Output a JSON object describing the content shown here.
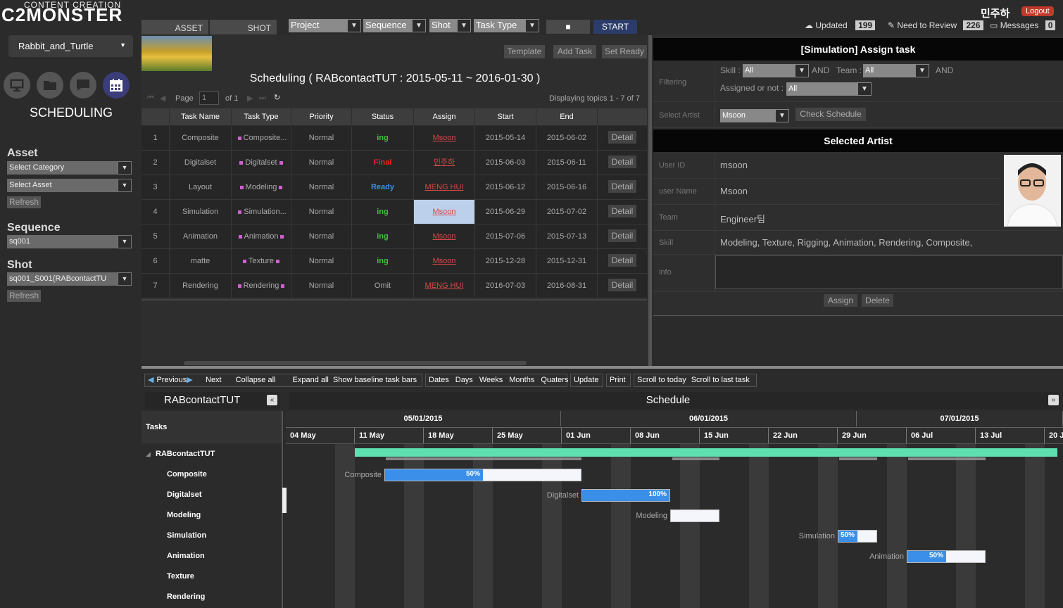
{
  "brand": {
    "line1": "CONTENT CREATION",
    "line2": "C2MONSTER"
  },
  "project": "Rabbit_and_Turtle",
  "nav": {
    "active": "SCHEDULING",
    "icons": [
      "monitor-icon",
      "folder-icon",
      "chat-icon",
      "calendar-icon"
    ]
  },
  "sidebar": {
    "asset_label": "Asset",
    "asset_category": "Select Category",
    "asset_asset": "Select Asset",
    "refresh1": "Refresh",
    "sequence_label": "Sequence",
    "sequence_value": "sq001",
    "shot_label": "Shot",
    "shot_value": "sq001_S001(RABcontactTU",
    "refresh2": "Refresh"
  },
  "tabs": {
    "asset": "ASSET",
    "shot": "SHOT"
  },
  "filters": {
    "project": "Project",
    "sequence": "Sequence",
    "shot": "Shot",
    "task_type": "Task Type",
    "start": "START"
  },
  "user": {
    "name": "민주하",
    "logout": "Logout",
    "updated_label": "Updated",
    "updated_count": "199",
    "review_label": "Need to Review",
    "review_count": "226",
    "messages_label": "Messages",
    "messages_count": "0"
  },
  "panel": {
    "template": "Template",
    "add_task": "Add Task",
    "set_ready": "Set Ready",
    "title": "Scheduling ( RABcontactTUT : 2015-05-11 ~ 2016-01-30 )",
    "page_label": "Page",
    "page_value": "1",
    "page_of": "of 1",
    "displaying": "Displaying topics 1 - 7 of 7"
  },
  "table": {
    "headers": [
      "Task Name",
      "Task Type",
      "Priority",
      "Status",
      "Assign",
      "Start",
      "End"
    ],
    "rows": [
      {
        "no": "1",
        "name": "Composite",
        "type": "Composite...",
        "priority": "Normal",
        "status": "ing",
        "status_class": "ing",
        "assign": "Msoon",
        "start": "2015-05-14",
        "end": "2015-06-02",
        "detail": "Detail"
      },
      {
        "no": "2",
        "name": "Digitalset",
        "type": "Digitalset",
        "priority": "Normal",
        "status": "Final",
        "status_class": "final",
        "assign": "민주하",
        "start": "2015-06-03",
        "end": "2015-06-11",
        "detail": "Detail"
      },
      {
        "no": "3",
        "name": "Layout",
        "type": "Modeling",
        "priority": "Normal",
        "status": "Ready",
        "status_class": "ready",
        "assign": "MENG HUI",
        "start": "2015-06-12",
        "end": "2015-06-16",
        "detail": "Detail"
      },
      {
        "no": "4",
        "name": "Simulation",
        "type": "Simulation...",
        "priority": "Normal",
        "status": "ing",
        "status_class": "ing",
        "assign": "Msoon",
        "start": "2015-06-29",
        "end": "2015-07-02",
        "detail": "Detail"
      },
      {
        "no": "5",
        "name": "Animation",
        "type": "Animation",
        "priority": "Normal",
        "status": "ing",
        "status_class": "ing",
        "assign": "Msoon",
        "start": "2015-07-06",
        "end": "2015-07-13",
        "detail": "Detail"
      },
      {
        "no": "6",
        "name": "matte",
        "type": "Texture",
        "priority": "Normal",
        "status": "ing",
        "status_class": "ing",
        "assign": "Msoon",
        "start": "2015-12-28",
        "end": "2015-12-31",
        "detail": "Detail"
      },
      {
        "no": "7",
        "name": "Rendering",
        "type": "Rendering",
        "priority": "Normal",
        "status": "Omit",
        "status_class": "omit",
        "assign": "MENG HUI",
        "start": "2016-07-03",
        "end": "2016-08-31",
        "detail": "Detail"
      }
    ]
  },
  "assign_panel": {
    "title": "[Simulation] Assign task",
    "filtering": "Filtering",
    "skill_label": "Skill :",
    "skill_value": "All",
    "and1": "AND",
    "team_label": "Team :",
    "team_value": "All",
    "and2": "AND",
    "assigned_label": "Assigned or not :",
    "assigned_value": "All",
    "select_artist": "Select Artist",
    "artist_value": "Msoon",
    "check_schedule": "Check Schedule",
    "selected_title": "Selected Artist",
    "user_id_label": "User ID",
    "user_id": "msoon",
    "user_name_label": "user Name",
    "user_name": "Msoon",
    "team_l": "Team",
    "team_v": "Engineer팀",
    "skill_l": "Skill",
    "skill_v": "Modeling, Texture, Rigging, Animation, Rendering, Composite,",
    "info_l": "info",
    "assign_btn": "Assign",
    "delete_btn": "Delete"
  },
  "gantt": {
    "toolbar": [
      "Previous",
      "Next",
      "Collapse all",
      "Expand all",
      "Show baseline task bars",
      "Dates",
      "Days",
      "Weeks",
      "Months",
      "Quaters",
      "Update",
      "Print",
      "Scroll to today",
      "Scroll to last task"
    ],
    "project_title": "RABcontactTUT",
    "schedule_title": "Schedule",
    "tasks_header": "Tasks",
    "months": [
      "05/01/2015",
      "06/01/2015",
      "07/01/2015"
    ],
    "weeks": [
      "04 May",
      "11 May",
      "18 May",
      "25 May",
      "01 Jun",
      "08 Jun",
      "15 Jun",
      "22 Jun",
      "29 Jun",
      "06 Jul",
      "13 Jul",
      "20 Ju"
    ],
    "tree": [
      "RABcontactTUT",
      "Composite",
      "Digitalset",
      "Modeling",
      "Simulation",
      "Animation",
      "Texture",
      "Rendering"
    ],
    "bars": [
      {
        "label": "Composite",
        "progress": 50,
        "pct": "50%"
      },
      {
        "label": "Digitalset",
        "progress": 100,
        "pct": "100%"
      },
      {
        "label": "Modeling",
        "progress": 0,
        "pct": ""
      },
      {
        "label": "Simulation",
        "progress": 50,
        "pct": "50%"
      },
      {
        "label": "Animation",
        "progress": 50,
        "pct": "50%"
      }
    ]
  },
  "colors": {
    "accent": "#3b8fe8",
    "bar_green": "#5ee0b0",
    "link": "#d84848"
  }
}
